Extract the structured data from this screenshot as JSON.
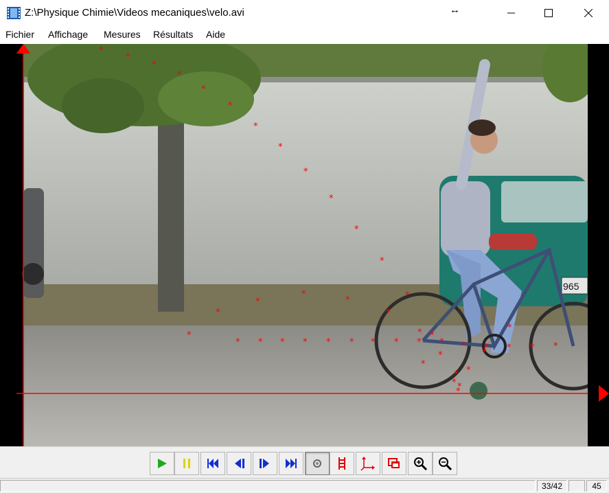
{
  "window": {
    "title": "Z:\\Physique Chimie\\Videos mecaniques\\velo.avi",
    "app_icon": "film-icon",
    "minimize_icon": "minimize-icon",
    "maximize_icon": "maximize-icon",
    "close_icon": "close-icon"
  },
  "menu": {
    "items": [
      {
        "label": "Fichier"
      },
      {
        "label": "Affichage"
      },
      {
        "label": "Mesures"
      },
      {
        "label": "Résultats"
      },
      {
        "label": "Aide"
      }
    ]
  },
  "video": {
    "description_icon": "video-frame",
    "axis_color": "#ff0000",
    "marker_color": "#ff0000",
    "license_plate": "965"
  },
  "toolbar": {
    "buttons": [
      {
        "name": "play-button",
        "icon": "play-icon",
        "color": "#1fa81f"
      },
      {
        "name": "pause-button",
        "icon": "pause-icon",
        "color": "#e0d000"
      },
      {
        "name": "first-frame-button",
        "icon": "skip-first-icon",
        "color": "#1030d0"
      },
      {
        "name": "previous-frame-button",
        "icon": "step-back-icon",
        "color": "#1030d0"
      },
      {
        "name": "next-frame-button",
        "icon": "step-forward-icon",
        "color": "#1030d0"
      },
      {
        "name": "last-frame-button",
        "icon": "skip-last-icon",
        "color": "#1030d0"
      },
      {
        "name": "point-mode-button",
        "icon": "point-icon",
        "color": "#666666"
      },
      {
        "name": "scale-button",
        "icon": "scale-icon",
        "color": "#e00000"
      },
      {
        "name": "axes-button",
        "icon": "axes-icon",
        "color": "#e00000"
      },
      {
        "name": "window-button",
        "icon": "window-icon",
        "color": "#e00000"
      },
      {
        "name": "zoom-in-button",
        "icon": "zoom-in-icon",
        "color": "#000000"
      },
      {
        "name": "zoom-out-button",
        "icon": "zoom-out-icon",
        "color": "#000000"
      }
    ]
  },
  "status": {
    "frame_counter": "33/42",
    "extra_value": "45"
  }
}
